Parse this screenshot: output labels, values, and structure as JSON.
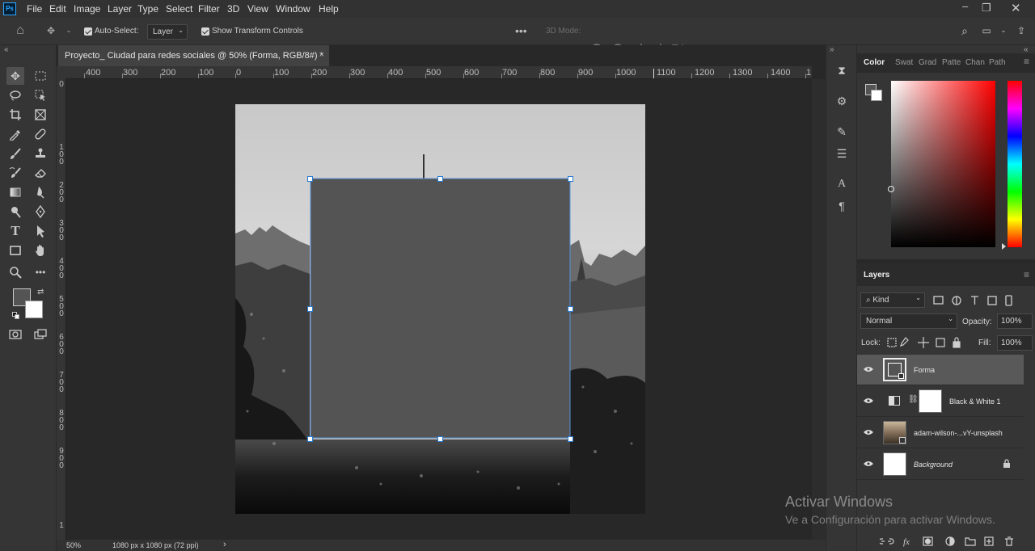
{
  "app": {
    "logo": "Ps"
  },
  "menu": [
    "File",
    "Edit",
    "Image",
    "Layer",
    "Type",
    "Select",
    "Filter",
    "3D",
    "View",
    "Window",
    "Help"
  ],
  "options": {
    "auto_select_label": "Auto-Select:",
    "auto_select_value": "Layer",
    "show_transform_label": "Show Transform Controls",
    "mode_3d_label": "3D Mode:"
  },
  "document": {
    "tab_title": "Proyecto_ Ciudad para redes sociales @ 50% (Forma, RGB/8#) *",
    "close_glyph": "×"
  },
  "ruler_h": [
    "400",
    "300",
    "200",
    "100",
    "0",
    "100",
    "200",
    "300",
    "400",
    "500",
    "600",
    "700",
    "800",
    "900",
    "1000",
    "1100",
    "1200",
    "1300",
    "1400",
    "1"
  ],
  "ruler_v": [
    "0",
    "1 0 0",
    "2 0 0",
    "3 0 0",
    "4 0 0",
    "5 0 0",
    "6 0 0",
    "7 0 0",
    "8 0 0",
    "9 0 0",
    "1"
  ],
  "status": {
    "zoom": "50%",
    "dimensions": "1080 px x 1080 px (72 ppi)",
    "arrow": "›"
  },
  "color_panel": {
    "tabs": [
      "Color",
      "Swat",
      "Grad",
      "Patte",
      "Chan",
      "Path"
    ],
    "hue": "#ff0000"
  },
  "layers_panel": {
    "title": "Layers",
    "kind_label": "Kind",
    "blend_mode": "Normal",
    "opacity_label": "Opacity:",
    "opacity_value": "100%",
    "lock_label": "Lock:",
    "fill_label": "Fill:",
    "fill_value": "100%",
    "layers": [
      {
        "name": "Forma",
        "selected": true
      },
      {
        "name": "Black & White 1",
        "selected": false
      },
      {
        "name": "adam-wilson-...vY-unsplash",
        "selected": false
      },
      {
        "name": "Background",
        "selected": false
      }
    ],
    "footer_icons": [
      "link-icon",
      "fx-icon",
      "mask-icon",
      "adjustment-icon",
      "group-icon",
      "new-layer-icon",
      "trash-icon"
    ]
  },
  "watermark": {
    "line1": "Activar Windows",
    "line2": "Ve a Configuración para activar Windows."
  },
  "canvas_fill": "#545454"
}
